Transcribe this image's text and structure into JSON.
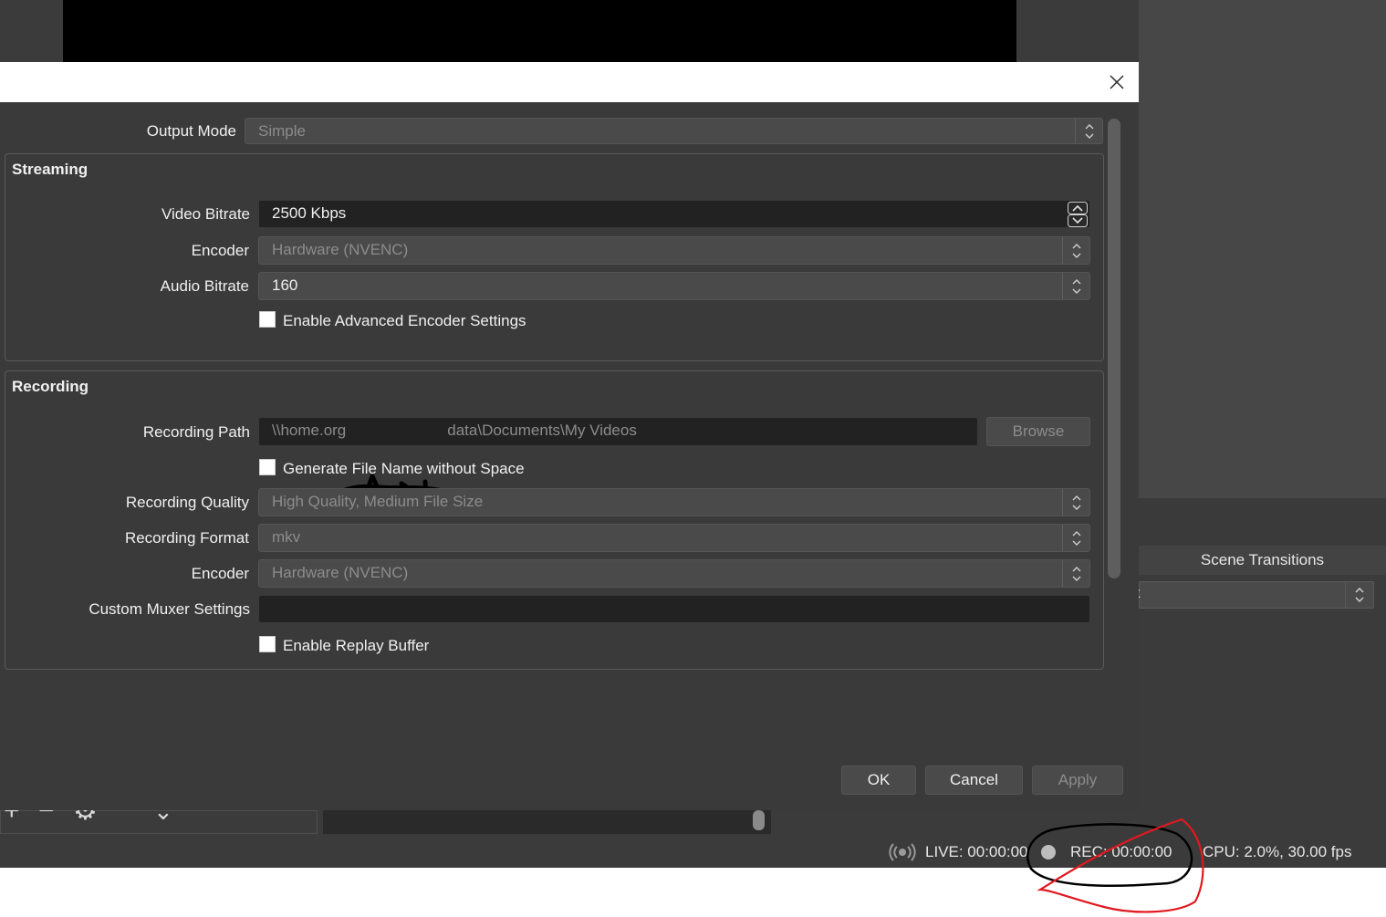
{
  "background": {
    "scene_transitions_title": "Scene Transitions",
    "transition_select_value": "t"
  },
  "status_bar": {
    "live": "LIVE: 00:00:00",
    "rec": "REC: 00:00:00",
    "cpu": "CPU: 2.0%, 30.00 fps"
  },
  "dialog": {
    "output_mode_label": "Output Mode",
    "output_mode_value": "Simple",
    "streaming": {
      "title": "Streaming",
      "video_bitrate_label": "Video Bitrate",
      "video_bitrate_value": "2500 Kbps",
      "encoder_label": "Encoder",
      "encoder_value": "Hardware (NVENC)",
      "audio_bitrate_label": "Audio Bitrate",
      "audio_bitrate_value": "160",
      "advanced_encoder_label": "Enable Advanced Encoder Settings"
    },
    "recording": {
      "title": "Recording",
      "path_label": "Recording Path",
      "path_value_start": "\\\\home.org",
      "path_value_end": "data\\Documents\\My Videos",
      "browse_label": "Browse",
      "gen_filename_label": "Generate File Name without Space",
      "quality_label": "Recording Quality",
      "quality_value": "High Quality, Medium File Size",
      "format_label": "Recording Format",
      "format_value": "mkv",
      "encoder_label": "Encoder",
      "encoder_value": "Hardware (NVENC)",
      "muxer_label": "Custom Muxer Settings",
      "muxer_value": "",
      "replay_buffer_label": "Enable Replay Buffer"
    },
    "buttons": {
      "ok": "OK",
      "cancel": "Cancel",
      "apply": "Apply"
    }
  },
  "colors": {
    "dialog_bg": "#3a3a3a",
    "field_bg": "#4a4a4a",
    "dark_field_bg": "#222222",
    "annotation_red": "#e0191f",
    "annotation_black": "#000000"
  }
}
